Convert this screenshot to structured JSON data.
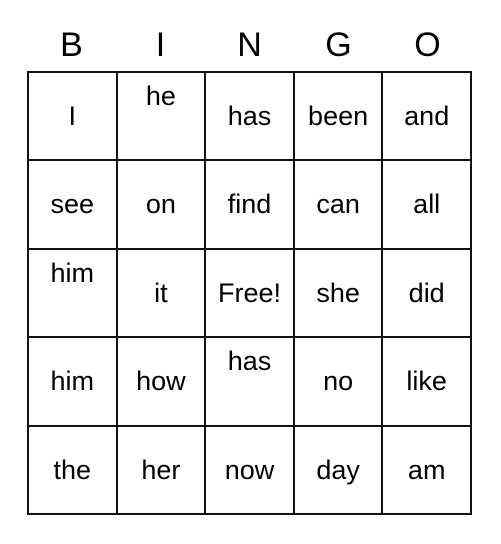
{
  "card": {
    "title": "BINGO",
    "header_letters": [
      "B",
      "I",
      "N",
      "G",
      "O"
    ],
    "grid_size": "5x5",
    "free_space_label": "Free!",
    "colors": {
      "background": "#ffffff",
      "grid_line": "#111111",
      "text": "#000000"
    },
    "rows": [
      [
        {
          "label": "I",
          "align": "middle",
          "free": false
        },
        {
          "label": "he",
          "align": "top",
          "free": false
        },
        {
          "label": "has",
          "align": "middle",
          "free": false
        },
        {
          "label": "been",
          "align": "middle",
          "free": false
        },
        {
          "label": "and",
          "align": "middle",
          "free": false
        }
      ],
      [
        {
          "label": "see",
          "align": "middle",
          "free": false
        },
        {
          "label": "on",
          "align": "middle",
          "free": false
        },
        {
          "label": "find",
          "align": "middle",
          "free": false
        },
        {
          "label": "can",
          "align": "middle",
          "free": false
        },
        {
          "label": "all",
          "align": "middle",
          "free": false
        }
      ],
      [
        {
          "label": "him",
          "align": "top",
          "free": false
        },
        {
          "label": "it",
          "align": "middle",
          "free": false
        },
        {
          "label": "Free!",
          "align": "middle",
          "free": true
        },
        {
          "label": "she",
          "align": "middle",
          "free": false
        },
        {
          "label": "did",
          "align": "middle",
          "free": false
        }
      ],
      [
        {
          "label": "him",
          "align": "middle",
          "free": false
        },
        {
          "label": "how",
          "align": "middle",
          "free": false
        },
        {
          "label": "has",
          "align": "top",
          "free": false
        },
        {
          "label": "no",
          "align": "middle",
          "free": false
        },
        {
          "label": "like",
          "align": "middle",
          "free": false
        }
      ],
      [
        {
          "label": "the",
          "align": "middle",
          "free": false
        },
        {
          "label": "her",
          "align": "middle",
          "free": false
        },
        {
          "label": "now",
          "align": "middle",
          "free": false
        },
        {
          "label": "day",
          "align": "middle",
          "free": false
        },
        {
          "label": "am",
          "align": "middle",
          "free": false
        }
      ]
    ]
  }
}
